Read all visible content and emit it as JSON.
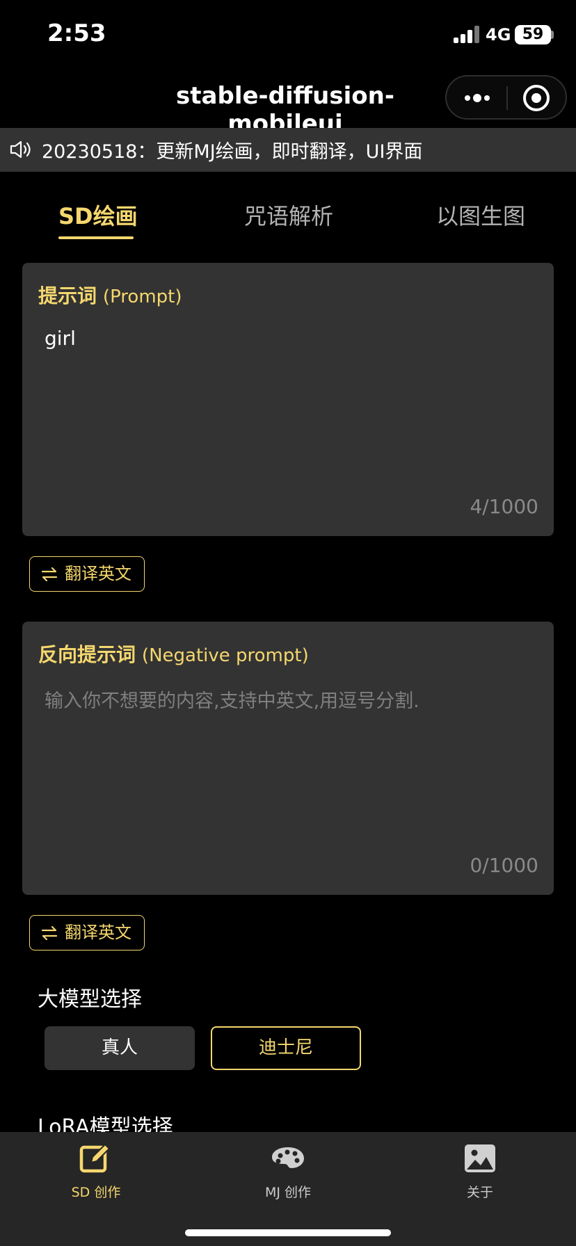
{
  "status_bar": {
    "time": "2:53",
    "network": "4G",
    "battery": "59"
  },
  "nav": {
    "title": "stable-diffusion-mobileui"
  },
  "notice": {
    "text": "20230518：更新MJ绘画，即时翻译，UI界面"
  },
  "tabs": [
    {
      "label": "SD绘画",
      "active": true
    },
    {
      "label": "咒语解析",
      "active": false
    },
    {
      "label": "以图生图",
      "active": false
    }
  ],
  "prompt": {
    "label_cn": "提示词",
    "label_en": "(Prompt)",
    "value": "girl",
    "count": "4/1000"
  },
  "negative_prompt": {
    "label_cn": "反向提示词",
    "label_en": "(Negative prompt)",
    "placeholder": "输入你不想要的内容,支持中英文,用逗号分割.",
    "count": "0/1000"
  },
  "translate_label": "翻译英文",
  "model_section": {
    "title": "大模型选择",
    "options": [
      "真人",
      "迪士尼"
    ],
    "selected": "迪士尼"
  },
  "lora_section": {
    "title": "LoRA模型选择"
  },
  "tabbar": [
    {
      "label": "SD 创作",
      "icon": "edit-icon",
      "active": true
    },
    {
      "label": "MJ 创作",
      "icon": "palette-icon",
      "active": false
    },
    {
      "label": "关于",
      "icon": "image-icon",
      "active": false
    }
  ],
  "colors": {
    "accent": "#f5d76e",
    "panel": "#333333",
    "background": "#000000"
  }
}
